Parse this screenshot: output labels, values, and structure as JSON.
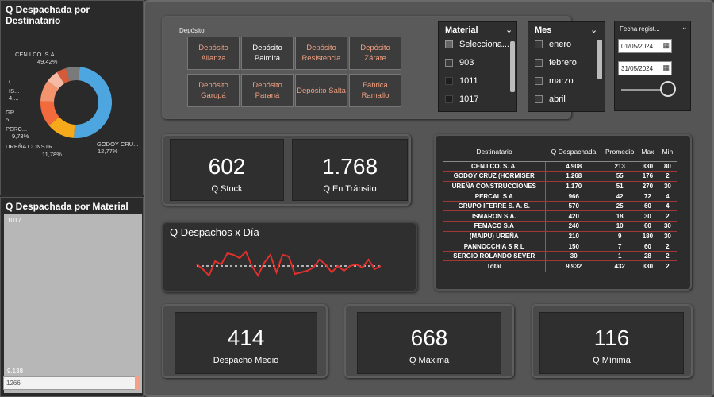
{
  "donut": {
    "title": "Q Despachada por Destinatario",
    "labels": [
      {
        "text": "CEN.I.CO. S.A.",
        "pct": "49,42%"
      },
      {
        "text": "(... ...",
        "pct": ""
      },
      {
        "text": "IS...",
        "pct": "4,..."
      },
      {
        "text": "GR...",
        "pct": "5,..."
      },
      {
        "text": "PERC...",
        "pct": "9,73%"
      },
      {
        "text": "UREÑA CONSTR...",
        "pct": "11,78%"
      },
      {
        "text": "GODOY CRU...",
        "pct": "12,77%"
      }
    ],
    "colors": {
      "cenico": "#4da6e0",
      "godoy": "#f7a91c",
      "urena": "#f36a3c",
      "percal": "#f4946e",
      "grupo": "#f6b9a4",
      "ismaron": "#d45a3a",
      "other": "#7a7a7a"
    }
  },
  "material_panel": {
    "title": "Q Despachada por Material",
    "top_label": "1017",
    "mid_value": "9.138",
    "bottom_value": "1266"
  },
  "deposito": {
    "title": "Depósito",
    "buttons": [
      {
        "label": "Depósito Alianza",
        "selected": false
      },
      {
        "label": "Depósito Palmira",
        "selected": true
      },
      {
        "label": "Depósito Resistencia",
        "selected": false
      },
      {
        "label": "Depósito Zárate",
        "selected": false
      },
      {
        "label": "Depósito Garupá",
        "selected": false
      },
      {
        "label": "Depósito Paraná",
        "selected": false
      },
      {
        "label": "Depósito Salta",
        "selected": false
      },
      {
        "label": "Fábrica Ramallo",
        "selected": false
      }
    ]
  },
  "material_slicer": {
    "title": "Material",
    "items": [
      "Selecciona...",
      "903",
      "1011",
      "1017"
    ]
  },
  "mes_slicer": {
    "title": "Mes",
    "items": [
      "enero",
      "febrero",
      "marzo",
      "abril"
    ]
  },
  "fecha": {
    "title": "Fecha regist...",
    "from": "01/05/2024",
    "to": "31/05/2024"
  },
  "kpis": {
    "stock": {
      "value": "602",
      "label": "Q Stock"
    },
    "transito": {
      "value": "1.768",
      "label": "Q En Tránsito"
    },
    "medio": {
      "value": "414",
      "label": "Despacho Medio"
    },
    "maxima": {
      "value": "668",
      "label": "Q Máxima"
    },
    "minima": {
      "value": "116",
      "label": "Q Mínima"
    }
  },
  "line_chart": {
    "title": "Q Despachos x Día"
  },
  "chart_data": {
    "type": "line",
    "title": "Q Despachos x Día",
    "xlabel": "",
    "ylabel": "",
    "series": [
      {
        "values": [
          0.55,
          0.4,
          0.2,
          0.65,
          0.55,
          0.9,
          0.85,
          0.75,
          0.95,
          0.5,
          0.2,
          0.6,
          0.85,
          0.3,
          0.85,
          0.8,
          0.25,
          0.3,
          0.35,
          0.45,
          0.7,
          0.55,
          0.3,
          0.5,
          0.35,
          0.5,
          0.55,
          0.45,
          0.7,
          0.4,
          0.5
        ]
      },
      {
        "values": [
          0.5,
          0.5
        ],
        "style": "dashed"
      }
    ],
    "colors": {
      "line": "#e0302c",
      "avg": "#ffffff"
    }
  },
  "table": {
    "headers": [
      "Destinatario",
      "Q Despachada",
      "Promedio",
      "Max",
      "Min"
    ],
    "rows": [
      [
        "CEN.I.CO. S. A.",
        "4.908",
        "213",
        "330",
        "80"
      ],
      [
        "GODOY CRUZ (HORMISER",
        "1.268",
        "55",
        "176",
        "2"
      ],
      [
        "UREÑA CONSTRUCCIONES",
        "1.170",
        "51",
        "270",
        "30"
      ],
      [
        "PERCAL S A",
        "966",
        "42",
        "72",
        "4"
      ],
      [
        "GRUPO IFERRE S. A. S.",
        "570",
        "25",
        "60",
        "4"
      ],
      [
        "ISMARON S.A.",
        "420",
        "18",
        "30",
        "2"
      ],
      [
        "FEMACO S.A",
        "240",
        "10",
        "60",
        "30"
      ],
      [
        "(MAIPU) UREÑA",
        "210",
        "9",
        "180",
        "30"
      ],
      [
        "PANNOCCHIA S R L",
        "150",
        "7",
        "60",
        "2"
      ],
      [
        "SERGIO ROLANDO SEVER",
        "30",
        "1",
        "28",
        "2"
      ]
    ],
    "total": [
      "Total",
      "9.932",
      "432",
      "330",
      "2"
    ]
  }
}
